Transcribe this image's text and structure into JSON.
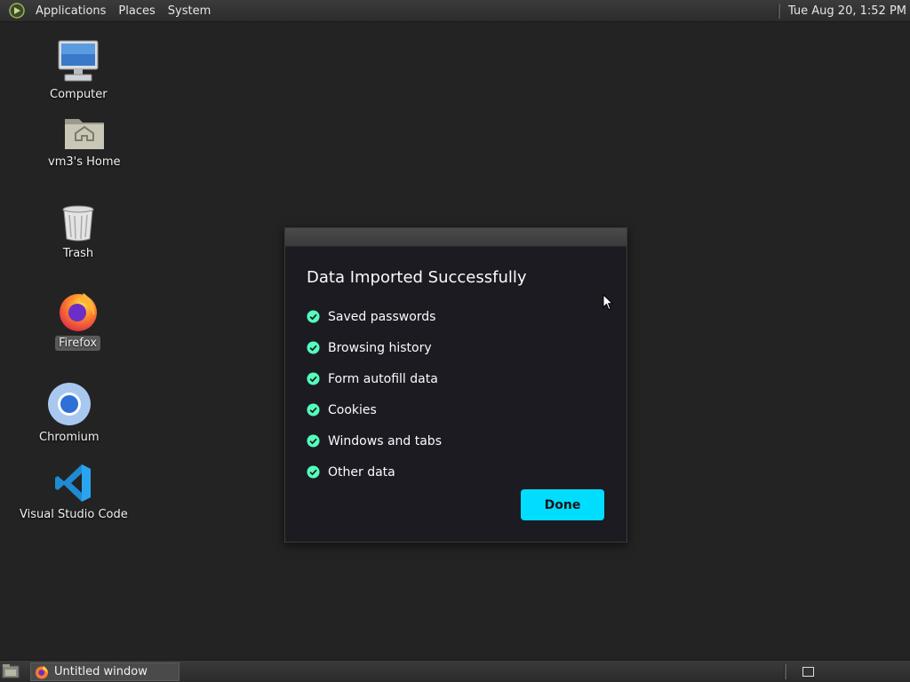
{
  "top_panel": {
    "menus": [
      "Applications",
      "Places",
      "System"
    ],
    "clock": "Tue Aug 20,  1:52 PM"
  },
  "desktop": {
    "icons": [
      {
        "label": "Computer",
        "icon": "computer-icon"
      },
      {
        "label": "vm3's Home",
        "icon": "home-folder-icon"
      },
      {
        "label": "Trash",
        "icon": "trash-icon"
      },
      {
        "label": "Firefox",
        "icon": "firefox-icon",
        "selected": true
      },
      {
        "label": "Chromium",
        "icon": "chromium-icon"
      },
      {
        "label": "Visual Studio Code",
        "icon": "vscode-icon"
      }
    ]
  },
  "dialog": {
    "title": "Data Imported Successfully",
    "items": [
      "Saved passwords",
      "Browsing history",
      "Form autofill data",
      "Cookies",
      "Windows and tabs",
      "Other data"
    ],
    "done_label": "Done",
    "accent": "#00ddff",
    "check_color": "#54ffbd"
  },
  "taskbar": {
    "window_title": "Untitled window"
  }
}
